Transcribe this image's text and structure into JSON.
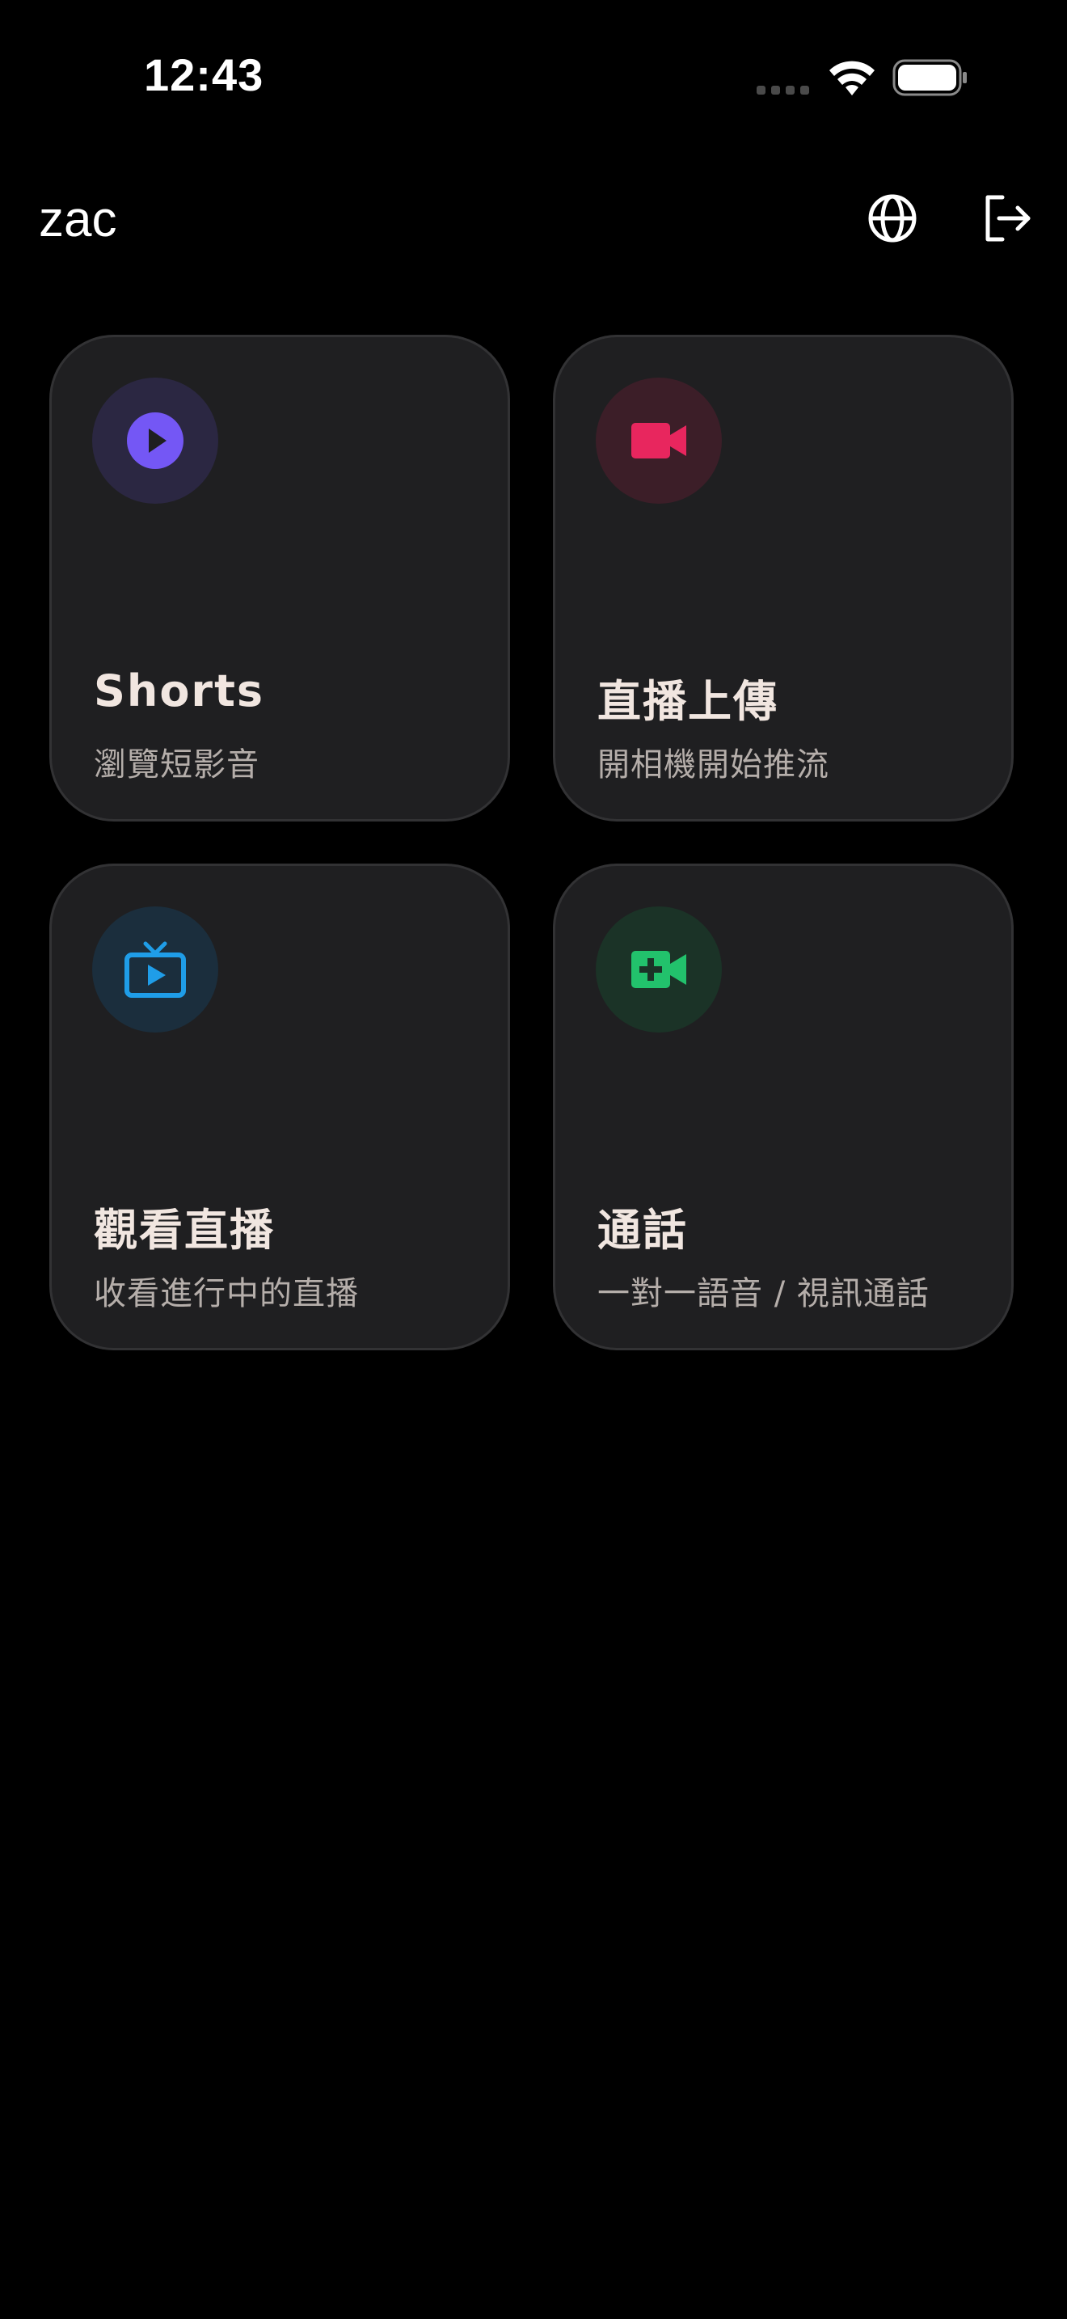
{
  "status_bar": {
    "time": "12:43"
  },
  "header": {
    "user_name": "zac",
    "language_icon": "globe-icon",
    "logout_icon": "logout-icon"
  },
  "cards": [
    {
      "title": "Shorts",
      "subtitle": "瀏覽短影音",
      "icon": "play-circle-icon",
      "accent": "#7457f5",
      "icon_bg": "#2b2742"
    },
    {
      "title": "直播上傳",
      "subtitle": "開相機開始推流",
      "icon": "video-camera-icon",
      "accent": "#e8265e",
      "icon_bg": "#3c1e28"
    },
    {
      "title": "觀看直播",
      "subtitle": "收看進行中的直播",
      "icon": "live-tv-icon",
      "accent": "#1f9de8",
      "icon_bg": "#1b2e3d"
    },
    {
      "title": "通話",
      "subtitle": "一對一語音 / 視訊通話",
      "icon": "video-call-icon",
      "accent": "#22c26c",
      "icon_bg": "#1b3327"
    }
  ]
}
